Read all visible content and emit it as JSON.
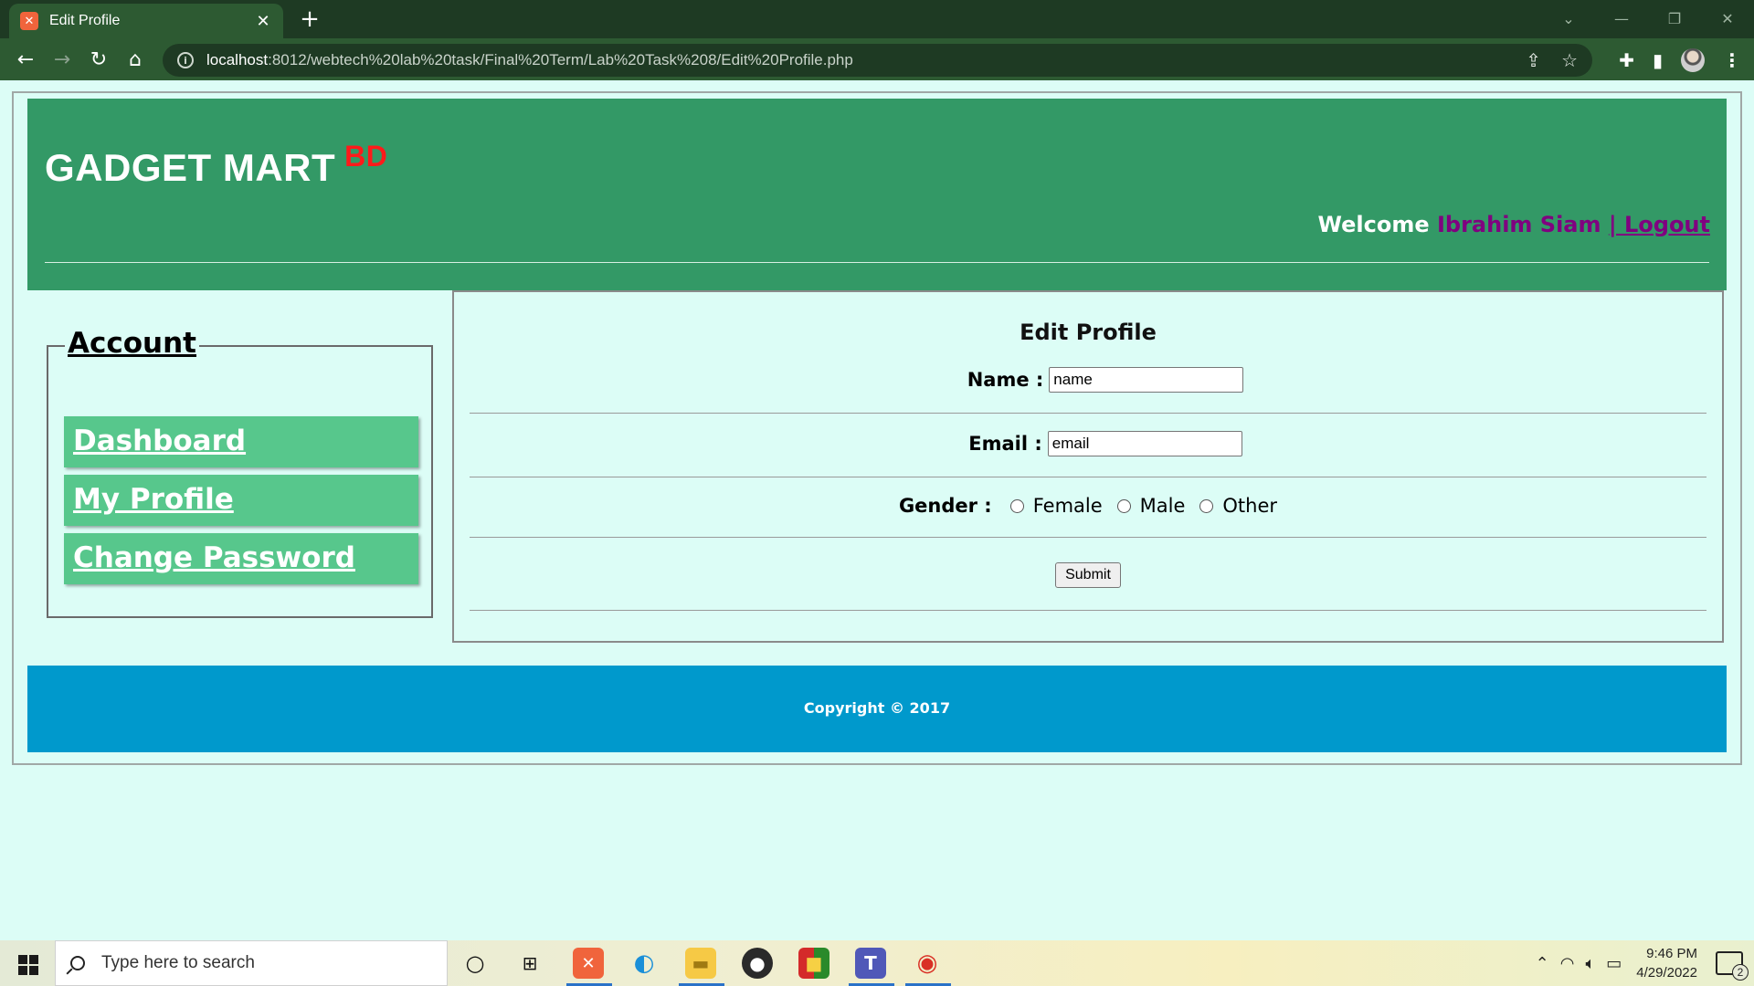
{
  "browser": {
    "tab_title": "Edit Profile",
    "tab_icon": "xampp-icon",
    "url_host": "localhost",
    "url_path": ":8012/webtech%20lab%20task/Final%20Term/Lab%20Task%208/Edit%20Profile.php",
    "colors": {
      "tabbar": "#1e3a23",
      "toolbar": "#2d5a32"
    }
  },
  "site": {
    "brand": "GADGET MART",
    "brand_suffix": "BD",
    "welcome_prefix": "Welcome",
    "user_name": "Ibrahim Siam",
    "logout_label": "| Logout",
    "colors": {
      "header": "#339966",
      "brand_suffix": "#ff1a1a",
      "user": "#800080",
      "footer": "#0099cc",
      "page_bg": "#dcfdf6"
    }
  },
  "sidebar": {
    "legend": "Account",
    "items": [
      {
        "label": "Dashboard"
      },
      {
        "label": "My Profile"
      },
      {
        "label": "Change Password"
      }
    ]
  },
  "form": {
    "title": "Edit Profile",
    "name_label": "Name :",
    "name_value": "name",
    "email_label": "Email :",
    "email_value": "email",
    "gender_label": "Gender :",
    "gender_options": [
      "Female",
      "Male",
      "Other"
    ],
    "submit_label": "Submit"
  },
  "footer": {
    "copyright": "Copyright © 2017"
  },
  "taskbar": {
    "search_placeholder": "Type here to search",
    "time": "9:46 PM",
    "date": "4/29/2022",
    "notification_count": "2"
  }
}
